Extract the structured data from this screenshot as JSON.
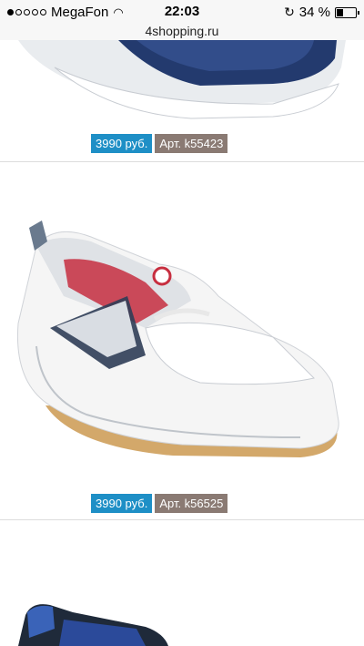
{
  "status_bar": {
    "carrier": "MegaFon",
    "time": "22:03",
    "battery_text": "34 %",
    "battery_level": 0.34
  },
  "browser": {
    "url": "4shopping.ru"
  },
  "products": [
    {
      "price": "3990 руб.",
      "article": "Арт. k55423"
    },
    {
      "price": "3990 руб.",
      "article": "Арт. k56525"
    }
  ]
}
